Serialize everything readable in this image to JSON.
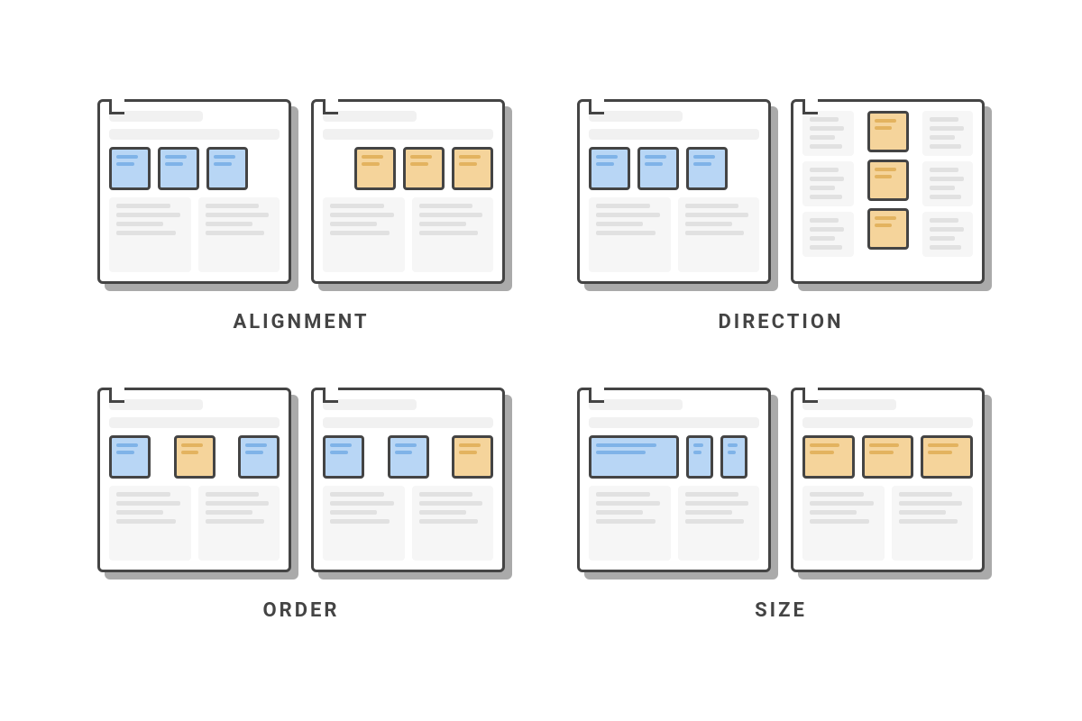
{
  "concepts": [
    {
      "key": "alignment",
      "label": "ALIGNMENT",
      "left": {
        "layout": "row-left",
        "boxes": [
          "blue",
          "blue",
          "blue"
        ],
        "sizes": [
          "sq",
          "sq",
          "sq"
        ]
      },
      "right": {
        "layout": "row-right",
        "boxes": [
          "orange",
          "orange",
          "orange"
        ],
        "sizes": [
          "sq",
          "sq",
          "sq"
        ]
      }
    },
    {
      "key": "direction",
      "label": "DIRECTION",
      "left": {
        "layout": "row-left",
        "boxes": [
          "blue",
          "blue",
          "blue"
        ],
        "sizes": [
          "sq",
          "sq",
          "sq"
        ]
      },
      "right": {
        "layout": "column",
        "boxes": [
          "orange",
          "orange",
          "orange"
        ],
        "sizes": [
          "sq",
          "sq",
          "sq"
        ]
      }
    },
    {
      "key": "order",
      "label": "ORDER",
      "left": {
        "layout": "row-spread",
        "boxes": [
          "blue",
          "orange",
          "blue"
        ],
        "sizes": [
          "sq",
          "sq",
          "sq"
        ]
      },
      "right": {
        "layout": "row-spread",
        "boxes": [
          "blue",
          "blue",
          "orange"
        ],
        "sizes": [
          "sq",
          "sq",
          "sq"
        ]
      }
    },
    {
      "key": "size",
      "label": "SIZE",
      "left": {
        "layout": "row-left",
        "boxes": [
          "blue",
          "blue",
          "blue"
        ],
        "sizes": [
          "wide",
          "narrow",
          "narrow"
        ]
      },
      "right": {
        "layout": "row-spread",
        "boxes": [
          "orange",
          "orange",
          "orange"
        ],
        "sizes": [
          "med",
          "med",
          "med"
        ]
      }
    }
  ],
  "colors": {
    "blue": "#b8d6f5",
    "orange": "#f5d49b",
    "outline": "#444444"
  }
}
